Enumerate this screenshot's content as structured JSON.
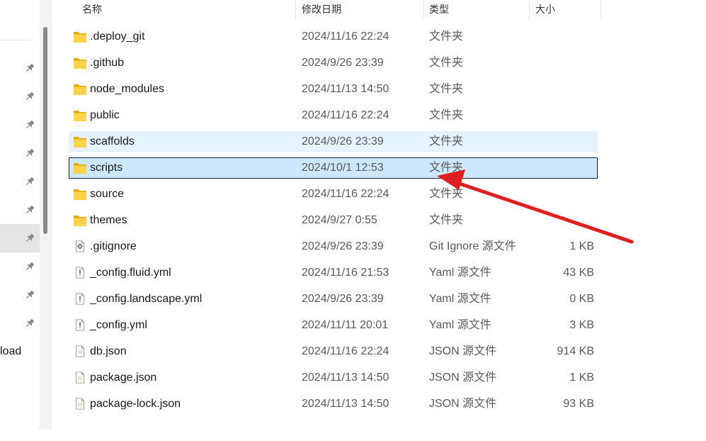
{
  "header": {
    "name": "名称",
    "date": "修改日期",
    "type": "类型",
    "size": "大小"
  },
  "nav": {
    "partial_label": "load",
    "pin_count": 10,
    "selected_pin_index": 6
  },
  "files": [
    {
      "name": ".deploy_git",
      "date": "2024/11/16 22:24",
      "type": "文件夹",
      "size": "",
      "icon": "folder-icon",
      "state": ""
    },
    {
      "name": ".github",
      "date": "2024/9/26 23:39",
      "type": "文件夹",
      "size": "",
      "icon": "folder-icon",
      "state": ""
    },
    {
      "name": "node_modules",
      "date": "2024/11/13 14:50",
      "type": "文件夹",
      "size": "",
      "icon": "folder-icon",
      "state": ""
    },
    {
      "name": "public",
      "date": "2024/11/16 22:24",
      "type": "文件夹",
      "size": "",
      "icon": "folder-icon",
      "state": ""
    },
    {
      "name": "scaffolds",
      "date": "2024/9/26 23:39",
      "type": "文件夹",
      "size": "",
      "icon": "folder-icon",
      "state": "hover"
    },
    {
      "name": "scripts",
      "date": "2024/10/1 12:53",
      "type": "文件夹",
      "size": "",
      "icon": "folder-icon",
      "state": "selected"
    },
    {
      "name": "source",
      "date": "2024/11/16 22:24",
      "type": "文件夹",
      "size": "",
      "icon": "folder-icon",
      "state": ""
    },
    {
      "name": "themes",
      "date": "2024/9/27 0:55",
      "type": "文件夹",
      "size": "",
      "icon": "folder-icon",
      "state": ""
    },
    {
      "name": ".gitignore",
      "date": "2024/9/26 23:39",
      "type": "Git Ignore 源文件",
      "size": "1 KB",
      "icon": "gear-file-icon",
      "state": ""
    },
    {
      "name": "_config.fluid.yml",
      "date": "2024/11/16 21:53",
      "type": "Yaml 源文件",
      "size": "43 KB",
      "icon": "yaml-file-icon",
      "state": ""
    },
    {
      "name": "_config.landscape.yml",
      "date": "2024/9/26 23:39",
      "type": "Yaml 源文件",
      "size": "0 KB",
      "icon": "yaml-file-icon",
      "state": ""
    },
    {
      "name": "_config.yml",
      "date": "2024/11/11 20:01",
      "type": "Yaml 源文件",
      "size": "3 KB",
      "icon": "yaml-file-icon",
      "state": ""
    },
    {
      "name": "db.json",
      "date": "2024/11/16 22:24",
      "type": "JSON 源文件",
      "size": "914 KB",
      "icon": "json-file-icon",
      "state": ""
    },
    {
      "name": "package.json",
      "date": "2024/11/13 14:50",
      "type": "JSON 源文件",
      "size": "1 KB",
      "icon": "json-file-icon",
      "state": ""
    },
    {
      "name": "package-lock.json",
      "date": "2024/11/13 14:50",
      "type": "JSON 源文件",
      "size": "93 KB",
      "icon": "json-file-icon",
      "state": ""
    }
  ],
  "annotation": {
    "arrow_color": "#e02020",
    "points_to": "scripts"
  }
}
